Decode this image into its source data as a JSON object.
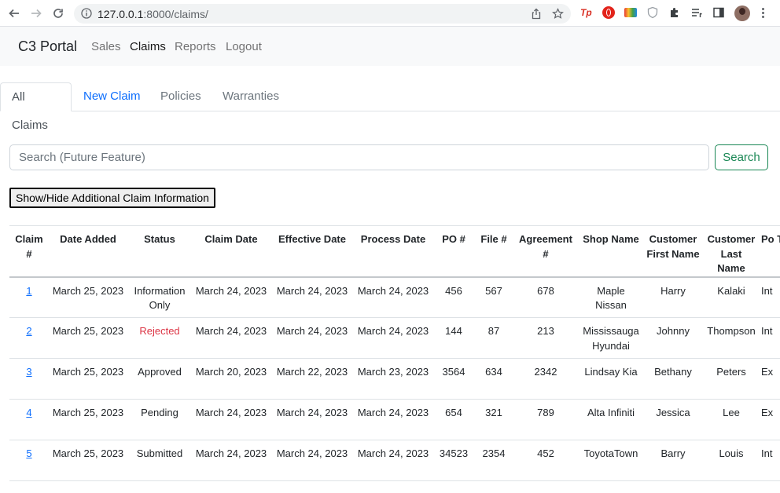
{
  "browser": {
    "url_host": "127.0.0.1",
    "url_rest": ":8000/claims/",
    "ext_tp": "Tp"
  },
  "navbar": {
    "brand": "C3 Portal",
    "links": [
      "Sales",
      "Claims",
      "Reports",
      "Logout"
    ],
    "active": "Claims"
  },
  "tabs": [
    {
      "label": "All Claims",
      "state": "active"
    },
    {
      "label": "New Claim",
      "state": "link"
    },
    {
      "label": "Policies",
      "state": "muted"
    },
    {
      "label": "Warranties",
      "state": "muted"
    }
  ],
  "search": {
    "placeholder": "Search (Future Feature)",
    "button": "Search"
  },
  "toggle_button": "Show/Hide Additional Claim Information",
  "table": {
    "headers": [
      "Claim #",
      "Date Added",
      "Status",
      "Claim Date",
      "Effective Date",
      "Process Date",
      "PO #",
      "File #",
      "Agreement #",
      "Shop Name",
      "Customer First Name",
      "Customer Last Name",
      "Po T"
    ],
    "rows": [
      [
        "1",
        "March 25, 2023",
        "Information Only",
        "March 24, 2023",
        "March 24, 2023",
        "March 24, 2023",
        "456",
        "567",
        "678",
        "Maple Nissan",
        "Harry",
        "Kalaki",
        "Int"
      ],
      [
        "2",
        "March 25, 2023",
        "Rejected",
        "March 24, 2023",
        "March 24, 2023",
        "March 24, 2023",
        "144",
        "87",
        "213",
        "Mississauga Hyundai",
        "Johnny",
        "Thompson",
        "Int"
      ],
      [
        "3",
        "March 25, 2023",
        "Approved",
        "March 20, 2023",
        "March 22, 2023",
        "March 23, 2023",
        "3564",
        "634",
        "2342",
        "Lindsay Kia",
        "Bethany",
        "Peters",
        "Ex"
      ],
      [
        "4",
        "March 25, 2023",
        "Pending",
        "March 24, 2023",
        "March 24, 2023",
        "March 24, 2023",
        "654",
        "321",
        "789",
        "Alta Infiniti",
        "Jessica",
        "Lee",
        "Ex"
      ],
      [
        "5",
        "March 25, 2023",
        "Submitted",
        "March 24, 2023",
        "March 24, 2023",
        "March 24, 2023",
        "34523",
        "2354",
        "452",
        "ToyotaTown",
        "Barry",
        "Louis",
        "Int"
      ]
    ]
  },
  "colors": {
    "link": "#0d6efd",
    "rejected": "#dc3545",
    "search_button": "#198754"
  }
}
